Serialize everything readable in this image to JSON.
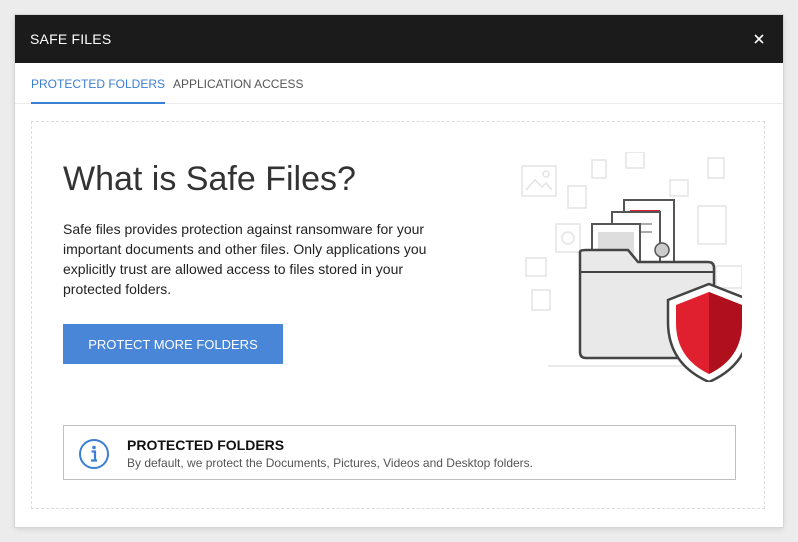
{
  "window": {
    "title": "SAFE FILES",
    "close_icon": "close-icon"
  },
  "tabs": [
    {
      "label": "PROTECTED FOLDERS",
      "active": true
    },
    {
      "label": "APPLICATION ACCESS",
      "active": false
    }
  ],
  "main": {
    "heading": "What is Safe Files?",
    "description": "Safe files provides protection against ransomware for your important documents and other files. Only applications you explicitly trust are allowed access to files stored in your protected folders.",
    "button_label": "PROTECT MORE FOLDERS",
    "illustration_icon": "folder-shield-illustration"
  },
  "info": {
    "icon": "info-icon",
    "title": "PROTECTED FOLDERS",
    "text": "By default, we protect the Documents, Pictures, Videos and Desktop folders."
  },
  "colors": {
    "titlebar": "#1b1b1b",
    "accent": "#3b7fd4",
    "button": "#4a86d8",
    "shield_red": "#e0202f",
    "shield_dark_red": "#b0101e"
  }
}
